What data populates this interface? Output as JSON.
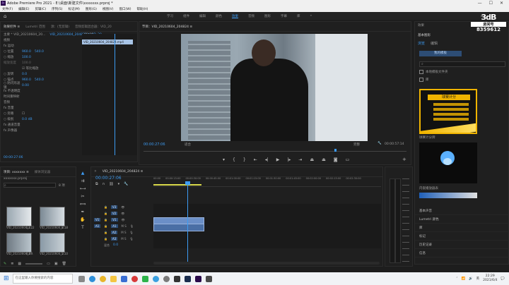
{
  "app": {
    "title": "Adobe Premiere Pro 2021 - E:\\桌面\\新建文件\\xxxxxxx.prproj *",
    "menu": [
      "文件(F)",
      "编辑(E)",
      "剪辑(C)",
      "序列(S)",
      "标记(M)",
      "图形(G)",
      "视图(V)",
      "窗口(W)",
      "帮助(H)"
    ],
    "window_controls": [
      "—",
      "☐",
      "✕"
    ]
  },
  "workspace": {
    "tabs": [
      "学习",
      "组件",
      "编辑",
      "颜色",
      "效果",
      "音频",
      "图形",
      "字幕",
      "库"
    ],
    "active": "效果",
    "more": "»"
  },
  "effect_controls": {
    "tabs": [
      "效果控件 ≡",
      "Lumetri 范围",
      "源：(无剪辑)",
      "音频剪辑混合器：VID_20"
    ],
    "source": "主要 * VID_20210604_20...",
    "sequence": "VID_20210604_204824 * VID_20...",
    "timecode_top": "00:00",
    "clip_label": "VID_20210604_204824.mp4",
    "section_video": "视频",
    "rows": [
      {
        "name": "fx 运动",
        "v1": "",
        "v2": ""
      },
      {
        "name": "○ 位置",
        "v1": "960.0",
        "v2": "540.0"
      },
      {
        "name": "○ 缩放",
        "v1": "100.0",
        "v2": ""
      },
      {
        "name": "  缩放宽度",
        "v1": "100.0",
        "v2": ""
      },
      {
        "name": "",
        "v1": "☑ 等比缩放",
        "v2": ""
      },
      {
        "name": "○ 旋转",
        "v1": "0.0",
        "v2": ""
      },
      {
        "name": "○ 锚点",
        "v1": "960.0",
        "v2": "540.0"
      },
      {
        "name": "○ 防闪烁滤镜",
        "v1": "0.00",
        "v2": ""
      },
      {
        "name": "fx 不透明度",
        "v1": "",
        "v2": ""
      },
      {
        "name": "  时间重映射",
        "v1": "",
        "v2": ""
      }
    ],
    "section_audio": "音频",
    "audio_rows": [
      {
        "name": "fx 音量",
        "v1": "",
        "v2": ""
      },
      {
        "name": "○ 旁路",
        "v1": "☐",
        "v2": ""
      },
      {
        "name": "○ 级别",
        "v1": "0.0 dB",
        "v2": ""
      },
      {
        "name": "fx 通道音量",
        "v1": "",
        "v2": ""
      },
      {
        "name": "fx 声像器",
        "v1": "",
        "v2": ""
      }
    ],
    "footer_time": "00:00:27:06"
  },
  "program": {
    "tab": "节目：VID_20210604_204824 ≡",
    "timecode": "00:00:27:06",
    "fit": "适合",
    "quality": "完整",
    "duration": "00:00:57:14"
  },
  "project": {
    "tabs": [
      "项目: xxxxxxx ≡",
      "媒体浏览器"
    ],
    "folder": "xxxxxxx.prproj",
    "count": "8 项",
    "items": [
      {
        "name": "VID_20210604_2...",
        "dur": "13:22"
      },
      {
        "name": "VID_20210604_2...",
        "dur": "8:18"
      },
      {
        "name": "VID_20210604_2...",
        "dur": "4:09"
      },
      {
        "name": "VID_20210604_2...",
        "dur": "5:10"
      },
      {
        "name": "VID_20210604_2...",
        "dur": "5:21"
      },
      {
        "name": "VID_20210604_2...",
        "dur": "57:14"
      }
    ]
  },
  "timeline": {
    "tab": "VID_20210604_204824 ≡",
    "timecode": "00:00:27:06",
    "ruler": [
      "00:00",
      "00:00:15:00",
      "00:00:30:00",
      "00:00:45:00",
      "00:01:00:00",
      "00:01:15:00",
      "00:01:30:00",
      "00:01:45:00",
      "00:02:00:00",
      "00:02:15:00",
      "00:02:30:00",
      "00:02:45:00"
    ],
    "tracks": [
      "V3",
      "V2",
      "V1",
      "A1",
      "A2",
      "A3"
    ],
    "master": "混合",
    "master_val": "0.0"
  },
  "effects": {
    "header": "效果",
    "title": "基本图形",
    "tabs": [
      "浏览",
      "编辑"
    ],
    "search_placeholder": "",
    "my_templates": "我的模板",
    "check1": "本地模板文件夹",
    "check2": "库",
    "template1": "球赛计分牌",
    "template1_text": "球赛计分",
    "template2": "内嵌播放器表",
    "list": [
      "基本声音",
      "Lumetri 颜色",
      "库",
      "标记",
      "历史记录",
      "信息"
    ]
  },
  "watermark": {
    "logo": "3dB",
    "sub": "房间号",
    "room": "8359612"
  },
  "taskbar": {
    "search_placeholder": "在这里输入你要搜索的内容",
    "time": "22:29",
    "date": "2021/6/4",
    "lang": "英"
  }
}
